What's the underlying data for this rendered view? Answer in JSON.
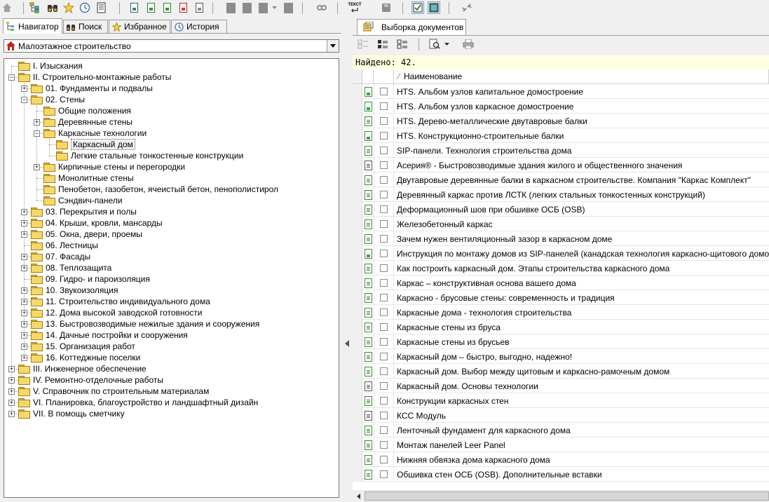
{
  "toolbar": {
    "icons": [
      "home-icon",
      "tree-icon",
      "binoculars-icon",
      "star-icon",
      "history-icon",
      "document-list-icon",
      "document-blue-icon",
      "document-green-icon",
      "document-green2-icon",
      "document-red-icon",
      "document-gray-icon",
      "document-disabled-icon",
      "document-disabled2-icon",
      "document-disabled3-icon",
      "dropdown-icon",
      "link-disabled-icon",
      "text-icon",
      "disk-disabled-icon",
      "check-icon",
      "image-icon",
      "unlink-icon"
    ],
    "text_button": "ТЕКСТ"
  },
  "left_tabs": [
    {
      "label": "Навигатор",
      "icon": "tree-icon"
    },
    {
      "label": "Поиск",
      "icon": "binoculars-icon"
    },
    {
      "label": "Избранное",
      "icon": "star-icon"
    },
    {
      "label": "История",
      "icon": "history-icon"
    }
  ],
  "combo": {
    "value": "Малоэтажное строительство"
  },
  "tree": [
    {
      "label": "I. Изыскания",
      "level": 0,
      "expander": "none"
    },
    {
      "label": "II. Строительно-монтажные работы",
      "level": 0,
      "expander": "minus"
    },
    {
      "label": "01. Фундаменты и подвалы",
      "level": 1,
      "expander": "plus"
    },
    {
      "label": "02. Стены",
      "level": 1,
      "expander": "minus"
    },
    {
      "label": "Общие положения",
      "level": 2,
      "expander": "none"
    },
    {
      "label": "Деревянные стены",
      "level": 2,
      "expander": "plus"
    },
    {
      "label": "Каркасные технологии",
      "level": 2,
      "expander": "minus"
    },
    {
      "label": "Каркасный дом",
      "level": 3,
      "expander": "none",
      "selected": true
    },
    {
      "label": "Легкие стальные тонкостенные конструкции",
      "level": 3,
      "expander": "none"
    },
    {
      "label": "Кирпичные стены и перегородки",
      "level": 2,
      "expander": "plus"
    },
    {
      "label": "Монолитные стены",
      "level": 2,
      "expander": "none"
    },
    {
      "label": "Пенобетон, газобетон, ячеистый бетон, пенополистирол",
      "level": 2,
      "expander": "none"
    },
    {
      "label": "Сэндвич-панели",
      "level": 2,
      "expander": "none"
    },
    {
      "label": "03. Перекрытия и полы",
      "level": 1,
      "expander": "plus"
    },
    {
      "label": "04. Крыши, кровли, мансарды",
      "level": 1,
      "expander": "plus"
    },
    {
      "label": "05. Окна, двери, проемы",
      "level": 1,
      "expander": "plus"
    },
    {
      "label": "06. Лестницы",
      "level": 1,
      "expander": "none"
    },
    {
      "label": "07. Фасады",
      "level": 1,
      "expander": "plus"
    },
    {
      "label": "08. Теплозащита",
      "level": 1,
      "expander": "plus"
    },
    {
      "label": "09. Гидро- и пароизоляция",
      "level": 1,
      "expander": "none"
    },
    {
      "label": "10. Звукоизоляция",
      "level": 1,
      "expander": "plus"
    },
    {
      "label": "11. Строительство индивидуального дома",
      "level": 1,
      "expander": "plus"
    },
    {
      "label": "12. Дома высокой заводской готовности",
      "level": 1,
      "expander": "plus"
    },
    {
      "label": "13. Быстровозводимые нежилые здания и сооружения",
      "level": 1,
      "expander": "plus"
    },
    {
      "label": "14. Дачные постройки и сооружения",
      "level": 1,
      "expander": "plus"
    },
    {
      "label": "15. Организация работ",
      "level": 1,
      "expander": "plus"
    },
    {
      "label": "16. Коттеджные поселки",
      "level": 1,
      "expander": "plus"
    },
    {
      "label": "III. Инженерное обеспечение",
      "level": 0,
      "expander": "plus"
    },
    {
      "label": "IV. Ремонтно-отделочные работы",
      "level": 0,
      "expander": "plus"
    },
    {
      "label": "V. Справочник по строительным материалам",
      "level": 0,
      "expander": "plus"
    },
    {
      "label": "VI. Планировка, благоустройство и ландшафтный дизайн",
      "level": 0,
      "expander": "plus"
    },
    {
      "label": "VII. В помощь сметчику",
      "level": 0,
      "expander": "plus"
    }
  ],
  "right_tab": {
    "label": "Выборка документов",
    "icon": "documents-icon"
  },
  "right_toolbar": {
    "icons": [
      "select-all-disabled-icon",
      "select-list-icon",
      "deselect-list-icon",
      "search-doc-icon",
      "dropdown-icon",
      "print-icon"
    ]
  },
  "found": "Найдено: 42.",
  "grid": {
    "header_name": "Наименование",
    "sort_glyph": "⁄",
    "rows": [
      {
        "name": "HTS. Альбом узлов капитальное домостроение",
        "icon": "filled"
      },
      {
        "name": "HTS. Альбом узлов каркасное домостроение",
        "icon": "filled"
      },
      {
        "name": "HTS. Дерево-металлические двутавровые балки",
        "icon": "lines"
      },
      {
        "name": "HTS. Конструкционно-строительные балки",
        "icon": "filled"
      },
      {
        "name": "SIP-панели. Технология строительства дома",
        "icon": "lines"
      },
      {
        "name": "Асерия® - Быстровозводимые здания жилого и общественного значения",
        "icon": "list"
      },
      {
        "name": "Двутавровые деревянные балки в каркасном строительстве. Компания \"Каркас Комплект\"",
        "icon": "lines"
      },
      {
        "name": "Деревянный каркас против ЛСТК (легких стальных тонкостенных конструкций)",
        "icon": "lines"
      },
      {
        "name": "Деформационный шов при обшивке ОСБ (OSB)",
        "icon": "lines"
      },
      {
        "name": "Железобетонный каркас",
        "icon": "lines"
      },
      {
        "name": "Зачем нужен вентиляционный зазор в каркасном доме",
        "icon": "lines"
      },
      {
        "name": "Инструкция по монтажу домов из SIP-панелей (канадская технология каркасно-щитового домостроения)",
        "icon": "filled"
      },
      {
        "name": "Как построить каркасный дом. Этапы строительства каркасного дома",
        "icon": "lines"
      },
      {
        "name": "Каркас – конструктивная основа вашего дома",
        "icon": "lines"
      },
      {
        "name": "Каркасно - брусовые стены: современность и традиция",
        "icon": "lines"
      },
      {
        "name": "Каркасные дома - технология строительства",
        "icon": "lines"
      },
      {
        "name": "Каркасные стены из бруса",
        "icon": "lines"
      },
      {
        "name": "Каркасные стены из брусьев",
        "icon": "lines"
      },
      {
        "name": "Каркасный дом – быстро, выгодно, надежно!",
        "icon": "lines"
      },
      {
        "name": "Каркасный дом. Выбор между щитовым и каркасно-рамочным домом",
        "icon": "lines"
      },
      {
        "name": "Каркасный дом. Основы технологии",
        "icon": "list"
      },
      {
        "name": "Конструкции каркасных стен",
        "icon": "lines"
      },
      {
        "name": "КСС Модуль",
        "icon": "list"
      },
      {
        "name": "Ленточный фундамент для каркасного дома",
        "icon": "lines"
      },
      {
        "name": "Монтаж панелей Leer Panel",
        "icon": "lines"
      },
      {
        "name": "Нижняя обвязка дома каркасного дома",
        "icon": "lines"
      },
      {
        "name": "Обшивка стен ОСБ (OSB). Дополнительные вставки",
        "icon": "lines"
      }
    ]
  }
}
